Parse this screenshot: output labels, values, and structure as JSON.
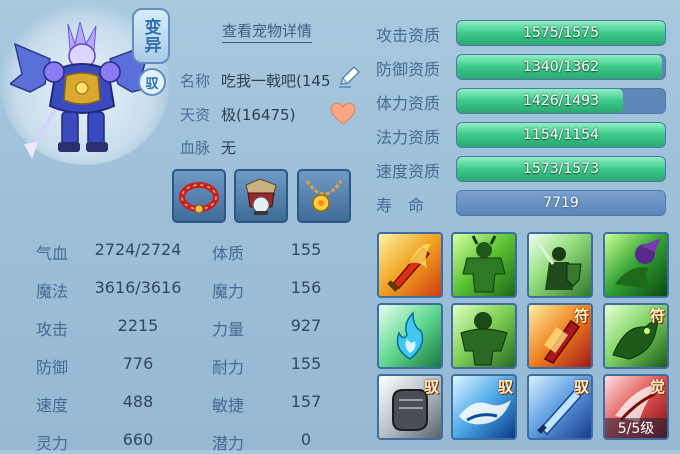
{
  "pet": {
    "mutate_badge": "变异",
    "tame_badge": "驭",
    "details_link": "查看宠物详情",
    "name_label": "名称",
    "name_value": "吃我一戟吧(145",
    "talent_label": "天资",
    "talent_value": "极(16475)",
    "bloodline_label": "血脉",
    "bloodline_value": "无"
  },
  "equipment": [
    {
      "name": "red-collar"
    },
    {
      "name": "armor-set"
    },
    {
      "name": "gold-necklace"
    }
  ],
  "stats": [
    {
      "label": "气血",
      "value": "2724/2724",
      "label2": "体质",
      "value2": "155"
    },
    {
      "label": "魔法",
      "value": "3616/3616",
      "label2": "魔力",
      "value2": "156"
    },
    {
      "label": "攻击",
      "value": "2215",
      "label2": "力量",
      "value2": "927"
    },
    {
      "label": "防御",
      "value": "776",
      "label2": "耐力",
      "value2": "155"
    },
    {
      "label": "速度",
      "value": "488",
      "label2": "敏捷",
      "value2": "157"
    },
    {
      "label": "灵力",
      "value": "660",
      "label2": "潜力",
      "value2": "0"
    }
  ],
  "aptitudes": [
    {
      "label": "攻击资质",
      "text": "1575/1575",
      "fill": 1.0
    },
    {
      "label": "防御资质",
      "text": "1340/1362",
      "fill": 0.984
    },
    {
      "label": "体力资质",
      "text": "1426/1493",
      "fill": 0.8
    },
    {
      "label": "法力资质",
      "text": "1154/1154",
      "fill": 1.0
    },
    {
      "label": "速度资质",
      "text": "1573/1573",
      "fill": 1.0
    }
  ],
  "life": {
    "label": "寿　命",
    "value": "7719"
  },
  "skills": [
    {
      "icon": "flame-blade-icon",
      "tag": ""
    },
    {
      "icon": "green-giant-icon",
      "tag": ""
    },
    {
      "icon": "shield-warrior-icon",
      "tag": ""
    },
    {
      "icon": "poison-strike-icon",
      "tag": ""
    },
    {
      "icon": "spirit-flame-icon",
      "tag": ""
    },
    {
      "icon": "green-brute-icon",
      "tag": ""
    },
    {
      "icon": "charm-dagger-icon",
      "tag": "符"
    },
    {
      "icon": "green-beast-icon",
      "tag": "符"
    },
    {
      "icon": "fist-icon",
      "tag": "驭"
    },
    {
      "icon": "water-dash-icon",
      "tag": "驭"
    },
    {
      "icon": "crystal-sword-icon",
      "tag": "驭"
    },
    {
      "icon": "red-slash-icon",
      "tag": "觉",
      "level": "5/5级"
    }
  ],
  "colors": {
    "bar_fill": "#3cc88a",
    "bar_track": "#5f88b8",
    "background": "#a8c8de"
  }
}
